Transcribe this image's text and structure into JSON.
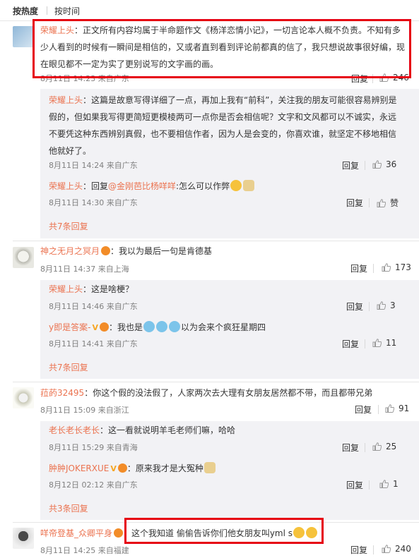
{
  "sort": {
    "hot": "按热度",
    "time": "按时间"
  },
  "reply_label": "回复",
  "comments": [
    {
      "user": "荣耀上头",
      "text": "：正文所有内容均属于半命题作文《杨洋恋情小记》，一切言论本人概不负责。不知有多少人看到的时候有一瞬间是相信的，又或者直到看到评论前都真的信了，我只想说故事很好编，现在眼见都不一定为实了更别说写的文字画的画。",
      "meta": "8月11日 14:23 来自广东",
      "likes": "246",
      "replies": [
        {
          "user": "荣耀上头",
          "text": "：这篇是故意写得详细了一点，再加上我有“前科”，关注我的朋友可能很容易辨别是假的，但如果我写得更简短更模棱两可一点你是否会相信呢？文字和文风都可以不诚实，永远不要凭这种东西辨别真假，也不要相信作者，因为人是会变的，你喜欢谁，就坚定不移地相信他就好了。",
          "meta": "8月11日 14:24 来自广东",
          "likes": "36"
        },
        {
          "user": "荣耀上头",
          "text_prefix": "：回复",
          "mention": "@金刚芭比杨咩咩",
          "text": ":怎么可以作弊",
          "meta": "8月11日 14:30 来自广东",
          "likes": "赞"
        }
      ],
      "more": "共7条回复"
    },
    {
      "user": "神之无月之冥月",
      "text": "：我以为最后一句是肯德基",
      "meta": "8月11日 14:37 来自上海",
      "likes": "173",
      "replies": [
        {
          "user": "荣耀上头",
          "text": "：这是啥梗？",
          "meta": "8月11日 14:46 来自广东",
          "likes": "3"
        },
        {
          "user": "y即是答案-",
          "text": "：我也是",
          "text_suffix": "以为会来个疯狂星期四",
          "meta": "8月11日 14:41 来自广东",
          "likes": "11"
        }
      ],
      "more": "共7条回复"
    },
    {
      "user": "菈菂32495",
      "text": "：你这个假的没法假了，人家两次去大理有女朋友居然都不带，而且都带兄弟",
      "meta": "8月11日 15:09 来自浙江",
      "likes": "91",
      "replies": [
        {
          "user": "老长老长老长",
          "text": "：这一看就说明羊毛老师们嘛，哈哈",
          "meta": "8月11日 15:29 来自青海",
          "likes": "25"
        },
        {
          "user": "肿肿JOKERXUE",
          "text": "：原来我才是大冤种",
          "meta": "8月12日 02:12 来自广东",
          "likes": "1"
        }
      ],
      "more": "共3条回复"
    },
    {
      "user": "咩帝登基_众卿平身",
      "text": "：这个我知道 偷偷告诉你们他女朋友叫yml s",
      "meta": "8月11日 14:25 来自福建",
      "likes": "240"
    }
  ],
  "colors": {
    "username": "#eb7350",
    "highlight_border": "#e60012",
    "reply_bg": "#f2f2f5"
  },
  "icons": {
    "like": "thumbs-up-icon",
    "badge": "medal-icon",
    "vip": "vip-v-icon"
  }
}
